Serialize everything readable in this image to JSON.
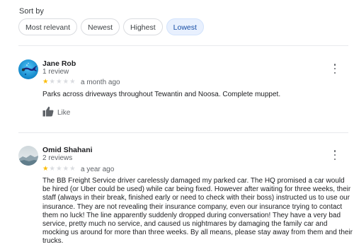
{
  "sort": {
    "label": "Sort by",
    "options": [
      "Most relevant",
      "Newest",
      "Highest",
      "Lowest"
    ],
    "selected": "Lowest"
  },
  "reviews": [
    {
      "name": "Jane Rob",
      "meta": "1 review",
      "rating": 1,
      "rating_max": 5,
      "date": "a month ago",
      "text": "Parks across driveways throughout Tewantin and Noosa. Complete muppet.",
      "like_label": "Like",
      "avatar_icon": "diver-photo-avatar"
    },
    {
      "name": "Omid Shahani",
      "meta": "2 reviews",
      "rating": 1,
      "rating_max": 5,
      "date": "a year ago",
      "text": "The BB Freight Service driver carelessly damaged my parked car. The HQ promised a car would be hired (or Uber could be used) while car being fixed. However after waiting for three weeks, their staff (always in their break, finished early or need to check with their boss) instructed us to use our insurance. They are not revealing their insurance company, even our insurance trying to contact them no luck! The line apparently suddenly dropped during conversation! They have a very bad service, pretty much no service, and caused us nightmares by damaging the family car and mocking us around for more than three weeks. By all means, please stay away from them and their trucks.",
      "avatar_icon": "landscape-photo-avatar"
    }
  ],
  "colors": {
    "star_filled": "#fbbc04",
    "star_empty": "#dadce0",
    "chip_selected_bg": "#e8f0fe",
    "chip_selected_text": "#174ea6"
  }
}
